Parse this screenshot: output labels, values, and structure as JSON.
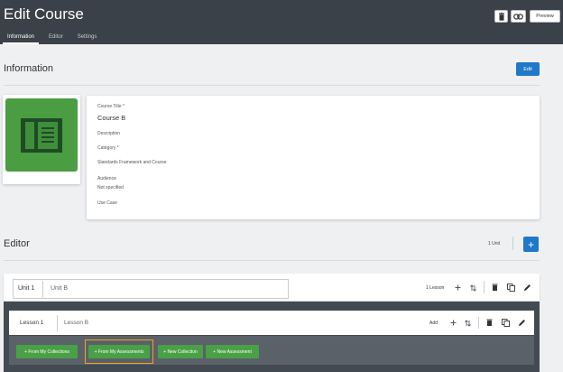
{
  "header": {
    "title": "Edit Course",
    "tabs": [
      "Information",
      "Editor",
      "Settings"
    ],
    "preview_label": "Preview"
  },
  "information": {
    "section_title": "Information",
    "edit_label": "Edit",
    "fields": {
      "course_title_label": "Course Title *",
      "course_title_value": "Course B",
      "description_label": "Description",
      "category_label": "Category *",
      "standards_label": "Standards Framework and Course",
      "audience_label": "Audience",
      "audience_value": "Not specified",
      "use_case_label": "Use Case"
    }
  },
  "editor": {
    "section_title": "Editor",
    "unit_count": "1 Unit",
    "add_symbol": "+",
    "unit": {
      "label": "Unit 1",
      "name": "Unit B",
      "lesson_count": "1 Lesson"
    },
    "lesson": {
      "label": "Lesson 1",
      "name": "Lesson B",
      "add_label": "Add"
    },
    "lesson_actions": [
      "+ From My Collections",
      "+ From My Assessments",
      "+ New Collection",
      "+ New Assessment"
    ]
  },
  "colors": {
    "header_bg": "#3b4148",
    "primary_blue": "#1f78c8",
    "action_green": "#4aa046",
    "highlight_orange": "#f0a21c",
    "thumbnail_green": "#4a9d41"
  }
}
